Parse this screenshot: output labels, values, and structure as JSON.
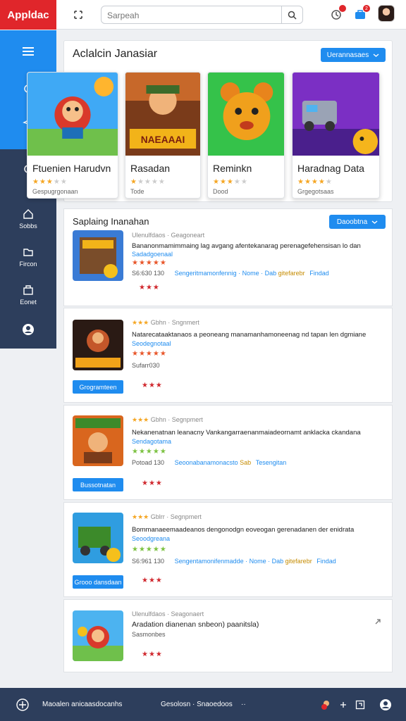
{
  "app": {
    "brand": "Appldac"
  },
  "topbar": {
    "search_placeholder": "Sarpeah",
    "notif_badge": "2"
  },
  "sidebar": {
    "items": [
      {
        "label": "Sobbs",
        "icon": "home-icon"
      },
      {
        "label": "Fircon",
        "icon": "folder-icon"
      },
      {
        "label": "Eonet",
        "icon": "bag-icon"
      }
    ]
  },
  "featured": {
    "title": "Aclalcin Janasiar",
    "button_label": "Uerannasaes",
    "cards": [
      {
        "title": "Ftuenien Harudvn",
        "rating": 3.5,
        "meta": "Gespugrgonaan"
      },
      {
        "title": "Rasadan",
        "rating": 1,
        "meta": "Tode"
      },
      {
        "title": "Reminkn",
        "rating": 3,
        "meta": "Dood"
      },
      {
        "title": "Haradnag Data",
        "rating": 4,
        "meta": "Grgegotsaas"
      }
    ]
  },
  "list": {
    "title": "Saplaing Inanahan",
    "button_label": "Daoobtna",
    "items": [
      {
        "category": "Ulenulfdaos · Geagoneart",
        "desc": "Bananonmamimmaing lag avgang afentekanarag perenagefehensisan lo dan",
        "dev": "Sadadgoenaal",
        "rating": 5,
        "rating_color": "#e8562a",
        "info": "S6:630 130",
        "tags": "Sengeritmamonfennig · Nome · Dab",
        "tags_accent": "gitefarebr",
        "tags_end": "Findad",
        "red": "★★★"
      },
      {
        "category": "Gbhn · Sngnmert",
        "desc": "Natarecataaktanaos a peoneang manamanhamoneenag nd tapan len dgmiane",
        "dev": "Seodegnotaal",
        "rating": 5,
        "rating_color": "#e8562a",
        "info": "Sufarr030",
        "button": "Grogramteen",
        "red": "★★★"
      },
      {
        "category": "Gbhn · Segnpmert",
        "desc": "Nekanenatnan leanacny Vankangarraenanmaiadeornamt anklacka ckandana",
        "dev": "Sendagotama",
        "rating": 5,
        "rating_color": "#7cc242",
        "info": "Potoad 130",
        "tags": "Seoonabanamonacsto",
        "tags_accent": "Sab",
        "tags_end": "Tesengitan",
        "button": "Bussotnatan",
        "red": "★★★"
      },
      {
        "category": "Gblrr · Segnpmert",
        "desc": "Bommanaeemaadeanos dengonodgn eoveogan gerenadanen der enidrata",
        "dev": "Seoodgreana",
        "rating": 5,
        "rating_color": "#7cc242",
        "info": "S6:961 130",
        "tags": "Sengentamonifenmadde · Nome · Dab",
        "tags_accent": "gitefarebr",
        "tags_end": "Findad",
        "button": "Grooo dansdaan",
        "red": "★★★"
      },
      {
        "category": "Ulenulfdaos · Seagonaert",
        "desc": "Aradation dianenan snbeon) paanitsla)",
        "info": "Sasmonbes",
        "red": "★★★"
      }
    ]
  },
  "bottombar": {
    "left_label": "Maoalen anicaasdocanhs",
    "mid_label": "Gesolosn · Snaoedoos",
    "more": "··"
  },
  "colors": {
    "brand": "#e0262b",
    "accent": "#1f8cef",
    "dark": "#2d3e5c"
  }
}
